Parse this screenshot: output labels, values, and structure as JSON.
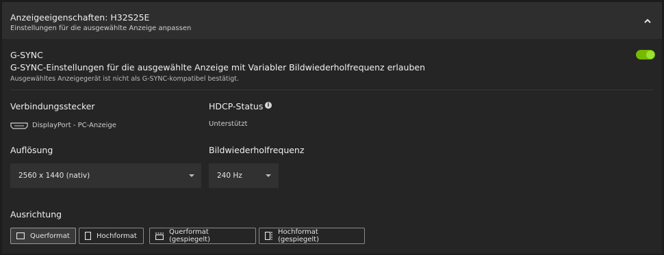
{
  "header": {
    "title": "Anzeigeeigenschaften: H32S25E",
    "subtitle": "Einstellungen für die ausgewählte Anzeige anpassen"
  },
  "gsync": {
    "title": "G-SYNC",
    "description": "G-SYNC-Einstellungen für die ausgewählte Anzeige mit Variabler Bildwiederholfrequenz erlauben",
    "note": "Ausgewähltes Anzeigegerät ist nicht als G-SYNC-kompatibel bestätigt.",
    "enabled": true,
    "accent": "#76b900"
  },
  "connector": {
    "label": "Verbindungsstecker",
    "value": "DisplayPort - PC-Anzeige",
    "icon": "displayport-icon"
  },
  "hdcp": {
    "label": "HDCP-Status",
    "value": "Unterstützt",
    "icon": "info-icon"
  },
  "resolution": {
    "label": "Auflösung",
    "selected": "2560 x 1440 (nativ)"
  },
  "refresh": {
    "label": "Bildwiederholfrequenz",
    "selected": "240 Hz"
  },
  "orientation": {
    "label": "Ausrichtung",
    "options": [
      {
        "label": "Querformat",
        "icon": "landscape-icon",
        "active": true
      },
      {
        "label": "Hochformat",
        "icon": "portrait-icon",
        "active": false
      },
      {
        "label": "Querformat (gespiegelt)",
        "icon": "landscape-flipped-icon",
        "active": false
      },
      {
        "label": "Hochformat (gespiegelt)",
        "icon": "portrait-flipped-icon",
        "active": false
      }
    ]
  }
}
